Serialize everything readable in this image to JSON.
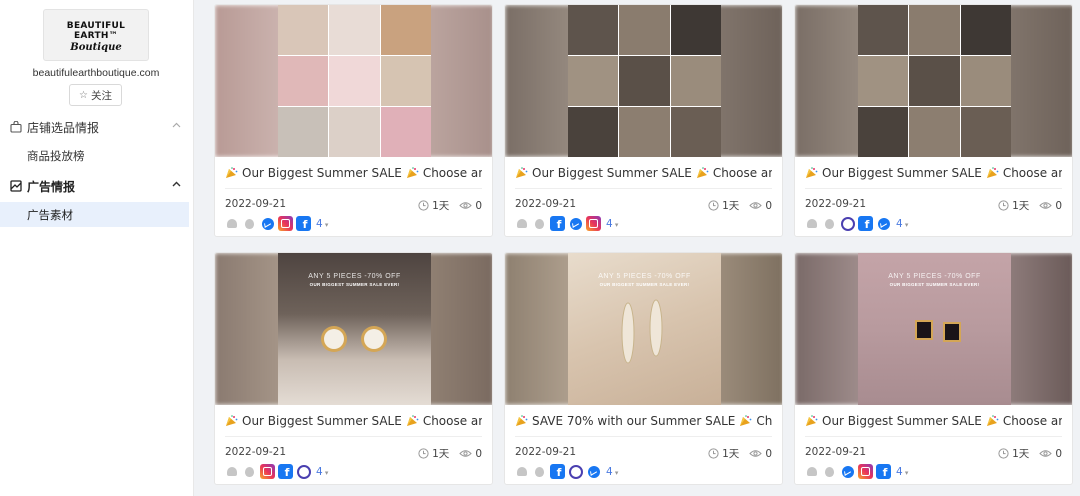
{
  "sidebar": {
    "logo_main": "BEAUTIFUL EARTH™",
    "logo_sub": "Boutique",
    "store_url": "beautifulearthboutique.com",
    "follow_label": "关注",
    "follow_icon": "star-outline-icon",
    "groups": [
      {
        "label": "店铺选品情报",
        "icon": "shop-icon",
        "expanded": false,
        "items": [
          "商品投放榜"
        ]
      },
      {
        "label": "广告情报",
        "icon": "ad-icon",
        "expanded": true,
        "items": [
          "广告素材"
        ]
      }
    ],
    "active_item": "广告素材",
    "active_bg": "#e8f0fc"
  },
  "cards": [
    {
      "title_pre": "Our Biggest Summer SALE",
      "title_post": "Choose any ...",
      "date": "2022-09-21",
      "duration": "1天",
      "views": "0",
      "more": "4",
      "platforms": [
        "android",
        "apple",
        "messenger",
        "instagram",
        "facebook"
      ]
    },
    {
      "title_pre": "Our Biggest Summer SALE",
      "title_post": "Choose any ...",
      "date": "2022-09-21",
      "duration": "1天",
      "views": "0",
      "more": "4",
      "platforms": [
        "android",
        "apple",
        "facebook",
        "messenger",
        "instagram"
      ]
    },
    {
      "title_pre": "Our Biggest Summer SALE",
      "title_post": "Choose any ...",
      "date": "2022-09-21",
      "duration": "1天",
      "views": "0",
      "more": "4",
      "platforms": [
        "android",
        "apple",
        "audience-network",
        "facebook",
        "messenger"
      ]
    },
    {
      "title_pre": "Our Biggest Summer SALE",
      "title_post": "Choose any ...",
      "date": "2022-09-21",
      "duration": "1天",
      "views": "0",
      "more": "4",
      "platforms": [
        "android",
        "apple",
        "instagram",
        "facebook",
        "audience-network"
      ],
      "overlay_big": "ANY 5 PIECES -70% OFF",
      "overlay_small": "OUR BIGGEST SUMMER SALE EVER!"
    },
    {
      "title_pre": "SAVE 70% with our Summer SALE",
      "title_post": "Choo...",
      "date": "2022-09-21",
      "duration": "1天",
      "views": "0",
      "more": "4",
      "platforms": [
        "android",
        "apple",
        "facebook",
        "audience-network",
        "messenger"
      ],
      "overlay_big": "ANY 5 PIECES -70% OFF",
      "overlay_small": "OUR BIGGEST SUMMER SALE EVER!"
    },
    {
      "title_pre": "Our Biggest Summer SALE",
      "title_post": "Choose any ...",
      "date": "2022-09-21",
      "duration": "1天",
      "views": "0",
      "more": "4",
      "platforms": [
        "android",
        "apple",
        "messenger",
        "instagram",
        "facebook"
      ],
      "overlay_big": "ANY 5 PIECES -70% OFF",
      "overlay_small": "OUR BIGGEST SUMMER SALE EVER!"
    }
  ],
  "icons": {
    "emoji": "party-popper-icon",
    "duration": "clock-icon",
    "views": "eye-icon",
    "more": "chevron-down-icon"
  }
}
